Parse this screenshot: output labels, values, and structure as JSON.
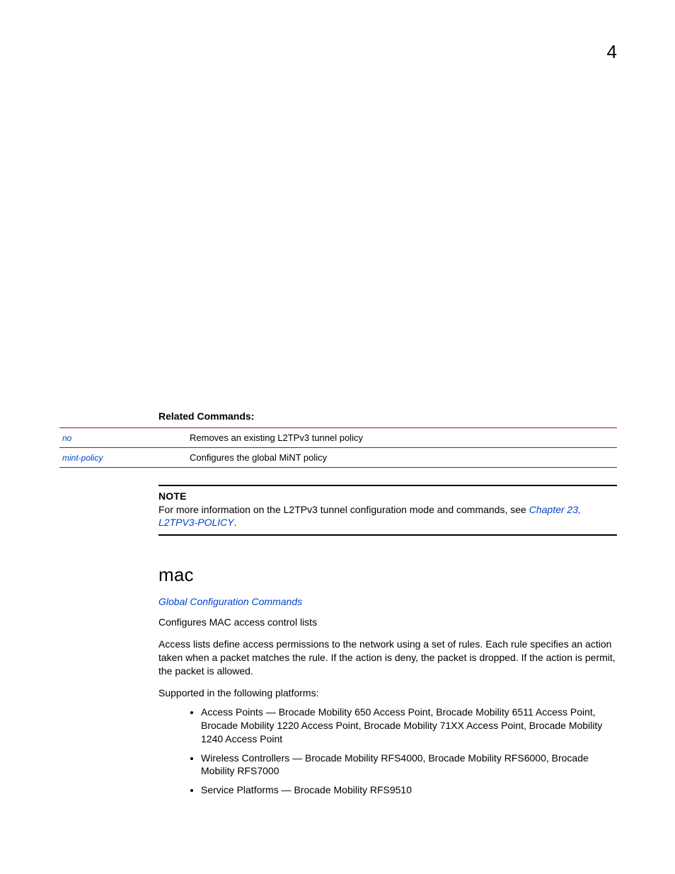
{
  "page_number": "4",
  "related": {
    "heading": "Related Commands:",
    "rows": [
      {
        "cmd": "no",
        "desc": "Removes an existing L2TPv3 tunnel policy"
      },
      {
        "cmd": "mint-policy",
        "desc": "Configures the global MiNT policy"
      }
    ]
  },
  "note": {
    "label": "NOTE",
    "text_before_link": "For more information on the L2TPv3 tunnel configuration mode and commands, see ",
    "link": "Chapter 23, L2TPV3-POLICY",
    "text_after_link": "."
  },
  "section": {
    "heading": "mac",
    "crossref": "Global Configuration Commands",
    "p1": "Configures MAC access control lists",
    "p2": "Access lists define access permissions to the network using a set of rules. Each rule specifies an action taken when a packet matches the rule. If the action is deny, the packet is dropped. If the action is permit, the packet is allowed.",
    "p3": "Supported in the following platforms:",
    "bullets": [
      "Access Points — Brocade Mobility 650 Access Point, Brocade Mobility 6511 Access Point, Brocade Mobility 1220 Access Point, Brocade Mobility 71XX Access Point, Brocade Mobility 1240 Access Point",
      "Wireless Controllers — Brocade Mobility RFS4000, Brocade Mobility RFS6000, Brocade Mobility RFS7000",
      "Service Platforms — Brocade Mobility RFS9510"
    ]
  }
}
